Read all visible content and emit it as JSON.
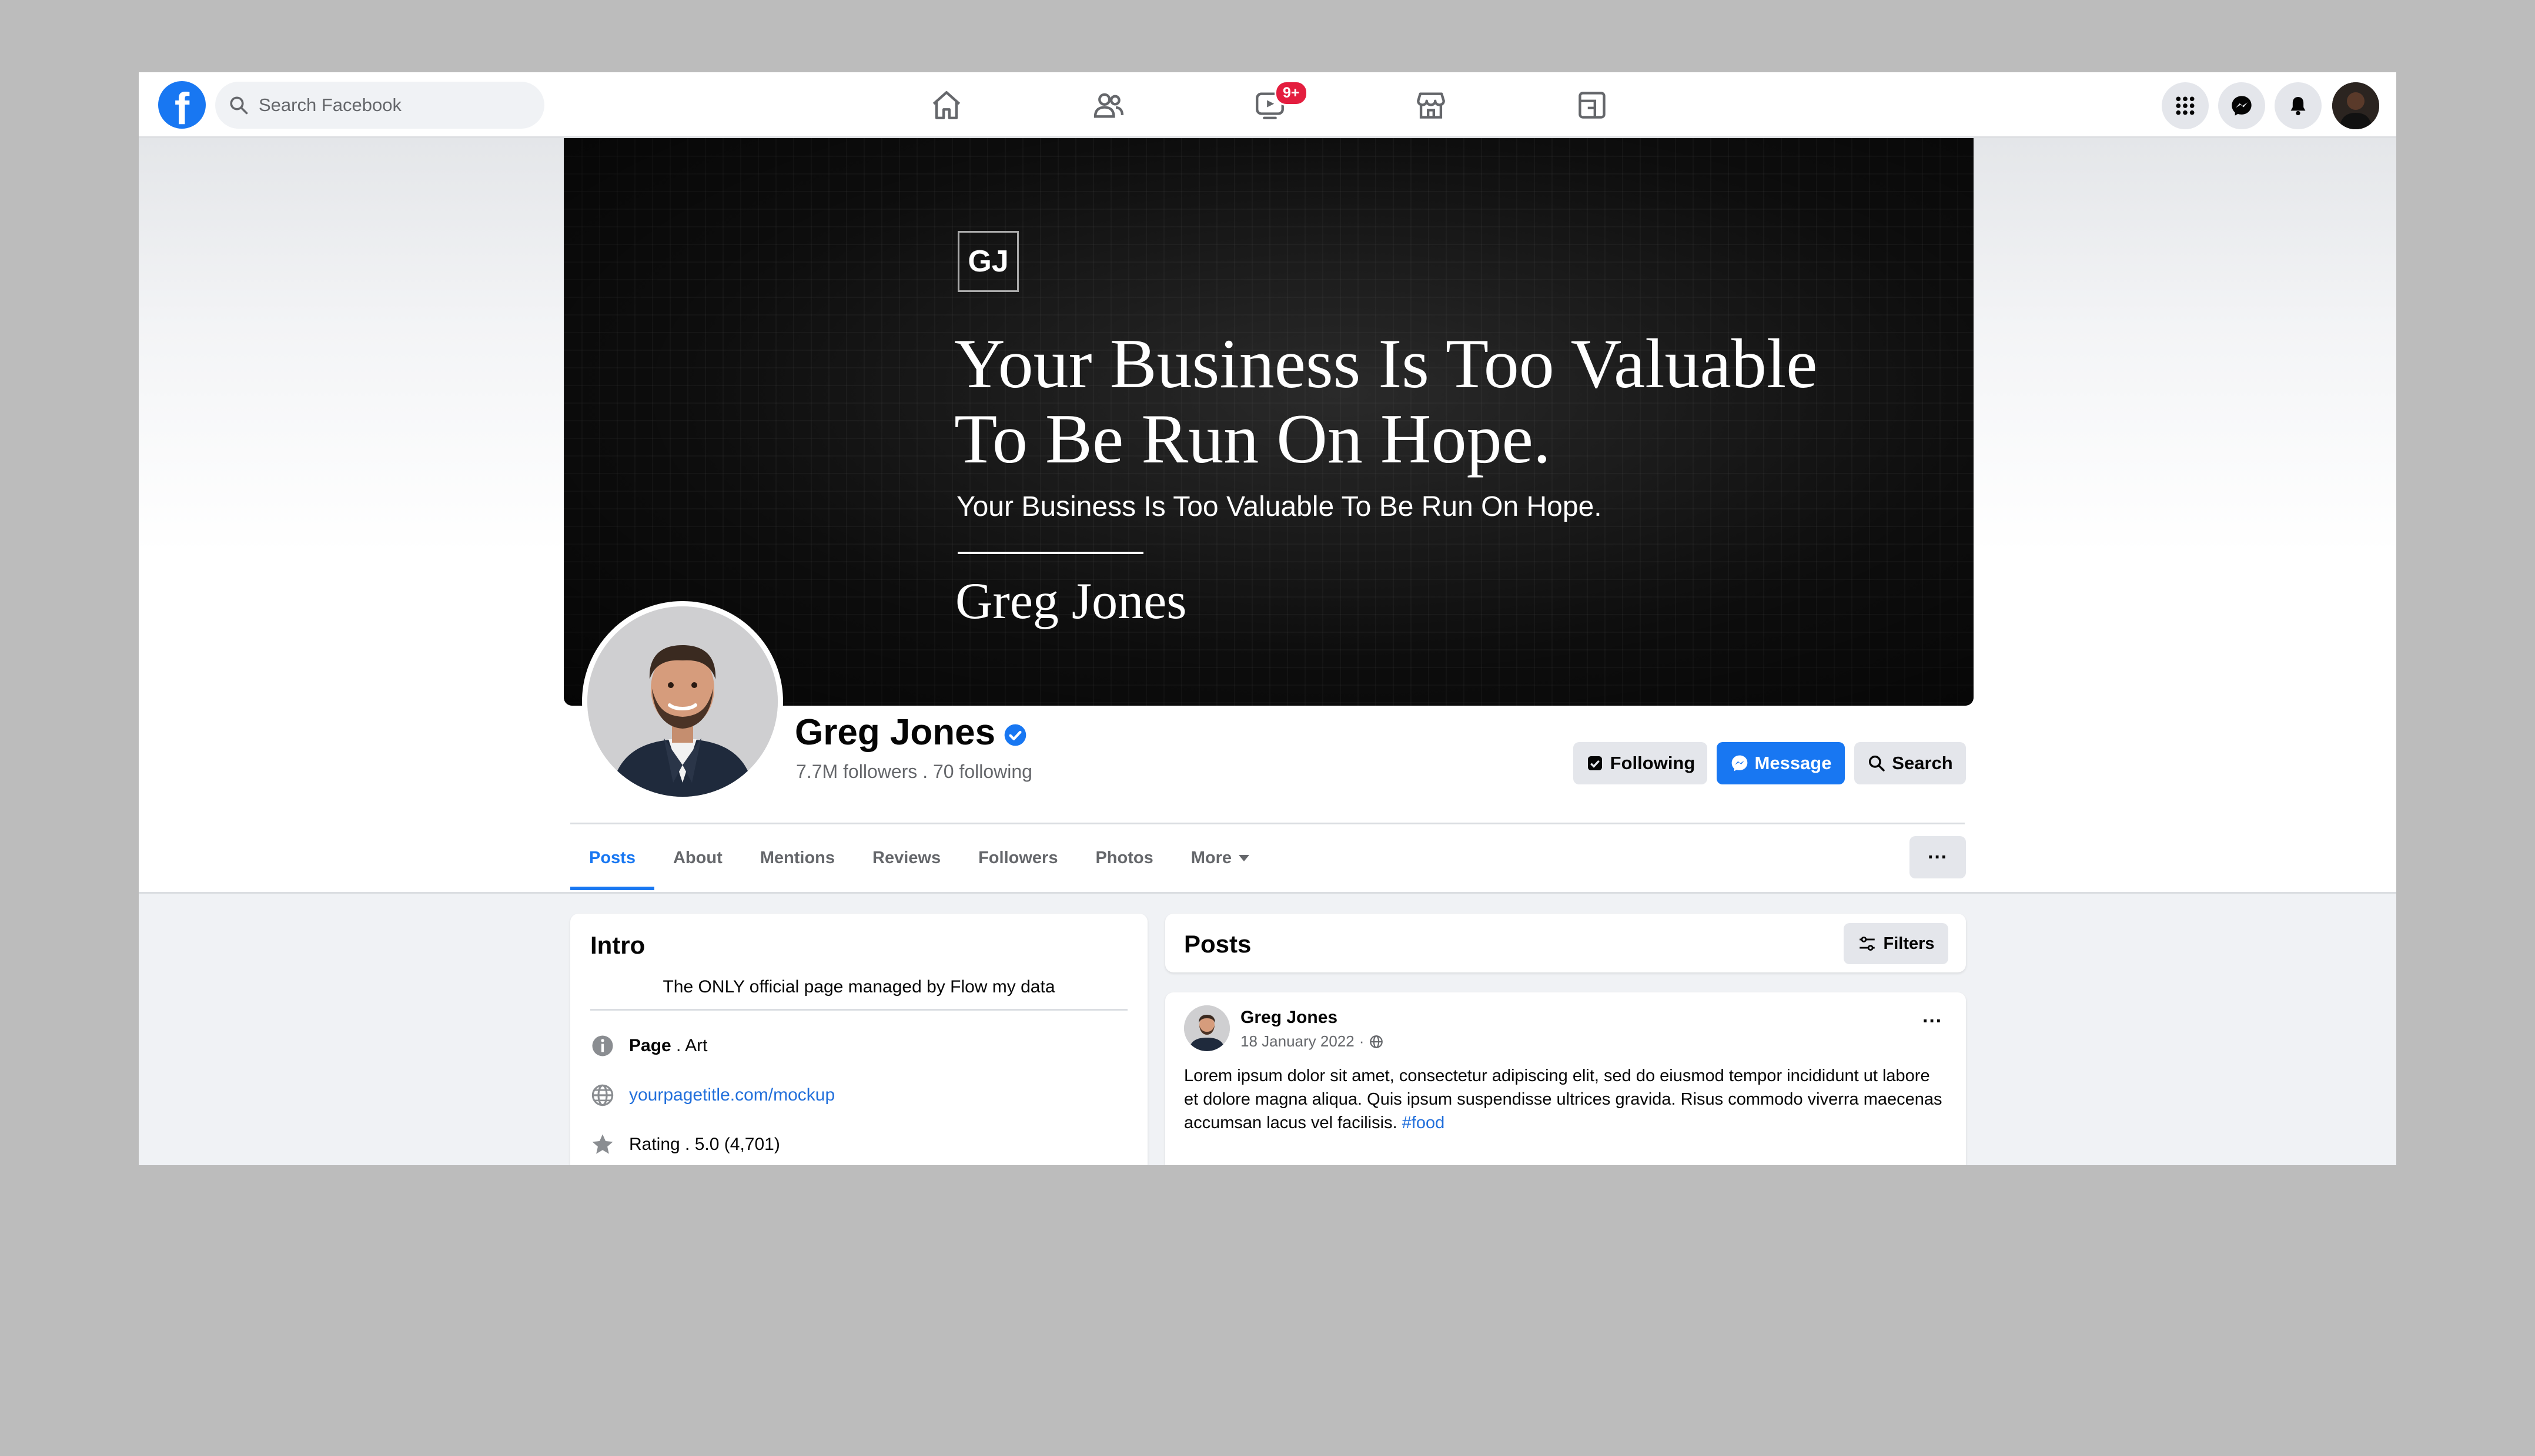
{
  "nav": {
    "logo": "f",
    "search_placeholder": "Search Facebook",
    "watch_badge": "9+",
    "icons": [
      "home-icon",
      "friends-icon",
      "watch-icon",
      "marketplace-icon",
      "gaming-icon"
    ]
  },
  "cover": {
    "monogram": "GJ",
    "headline": "Your Business Is Too Valuable To Be Run On Hope.",
    "subline": "Your Business Is Too Valuable To Be Run On Hope.",
    "signature": "Greg Jones"
  },
  "profile": {
    "name": "Greg Jones",
    "stats": "7.7M followers . 70 following",
    "buttons": {
      "following": "Following",
      "message": "Message",
      "search": "Search"
    }
  },
  "tabs": [
    "Posts",
    "About",
    "Mentions",
    "Reviews",
    "Followers",
    "Photos",
    "More"
  ],
  "more_dots": "···",
  "intro": {
    "title": "Intro",
    "description": "The ONLY official page managed by Flow my data",
    "page_label": "Page",
    "page_category": " . Art",
    "website": "yourpagetitle.com/mockup",
    "rating": "Rating . 5.0 (4,701)"
  },
  "posts": {
    "title": "Posts",
    "filters_label": "Filters",
    "items": [
      {
        "author": "Greg Jones",
        "date": "18 January 2022",
        "separator": "·",
        "text": "Lorem ipsum dolor sit amet, consectetur adipiscing elit, sed do eiusmod tempor incididunt ut labore et dolore magna aliqua. Quis ipsum suspendisse ultrices gravida. Risus commodo viverra maecenas accumsan lacus vel facilisis. ",
        "hashtag": "#food",
        "menu": "···"
      }
    ]
  },
  "colors": {
    "accent": "#1877f2",
    "badge": "#e41e3f",
    "text_secondary": "#65676b"
  }
}
